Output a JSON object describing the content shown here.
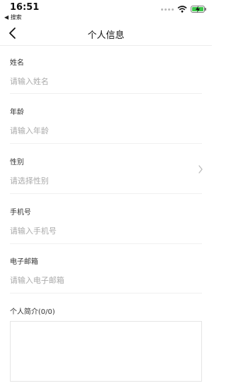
{
  "status_bar": {
    "time": "16:51",
    "back_app": "◀ 搜索"
  },
  "nav": {
    "title": "个人信息"
  },
  "form": {
    "fields": [
      {
        "label": "姓名",
        "placeholder": "请输入姓名"
      },
      {
        "label": "年龄",
        "placeholder": "请输入年龄"
      },
      {
        "label": "性别",
        "placeholder": "请选择性别"
      },
      {
        "label": "手机号",
        "placeholder": "请输入手机号"
      },
      {
        "label": "电子邮箱",
        "placeholder": "请输入电子邮箱"
      }
    ],
    "bio_label": "个人简介(0/0)"
  },
  "colors": {
    "battery": "#3cc84a",
    "placeholder": "#aaaaaa"
  }
}
